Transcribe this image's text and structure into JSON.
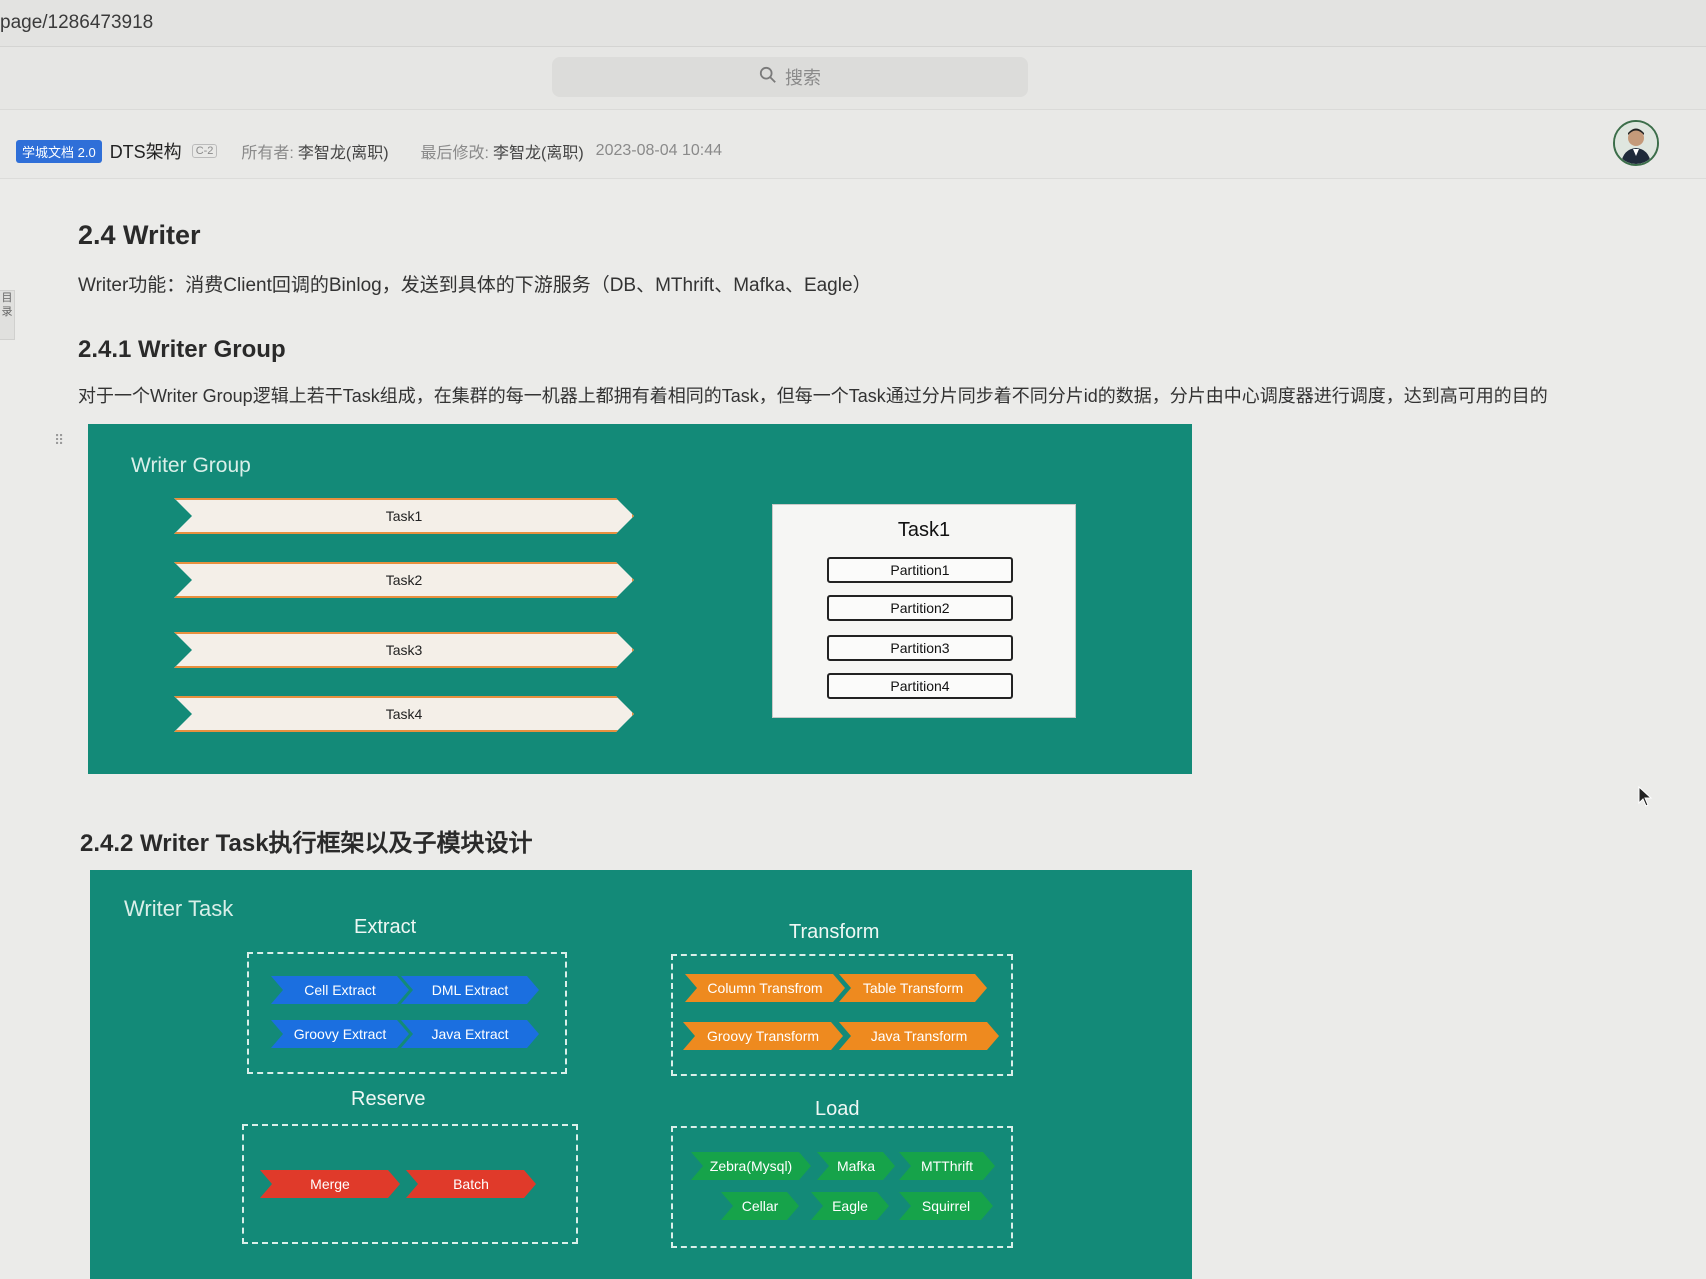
{
  "browser": {
    "url": "page/1286473918"
  },
  "search": {
    "placeholder": "搜索"
  },
  "doc": {
    "badge": "学城文档 2.0",
    "title": "DTS架构",
    "version": "C-2",
    "owner_label": "所有者:",
    "owner": "李智龙(离职)",
    "modified_label": "最后修改:",
    "modified_by": "李智龙(离职)",
    "modified_time": "2023-08-04 10:44"
  },
  "toc": {
    "label": "目录"
  },
  "content": {
    "h_writer": "2.4 Writer",
    "p_writer": "Writer功能：消费Client回调的Binlog，发送到具体的下游服务（DB、MThrift、Mafka、Eagle）",
    "h_group": "2.4.1 Writer Group",
    "p_group": "对于一个Writer Group逻辑上若干Task组成，在集群的每一机器上都拥有着相同的Task，但每一个Task通过分片同步着不同分片id的数据，分片由中心调度器进行调度，达到高可用的目的",
    "h_task": "2.4.2 Writer Task执行框架以及子模块设计"
  },
  "writer_group_diagram": {
    "title": "Writer Group",
    "tasks": [
      "Task1",
      "Task2",
      "Task3",
      "Task4"
    ],
    "detail_title": "Task1",
    "partitions": [
      "Partition1",
      "Partition2",
      "Partition3",
      "Partition4"
    ]
  },
  "writer_task_diagram": {
    "title": "Writer Task",
    "extract": {
      "title": "Extract",
      "items": [
        "Cell Extract",
        "DML Extract",
        "Groovy Extract",
        "Java Extract"
      ]
    },
    "transform": {
      "title": "Transform",
      "items": [
        "Column Transfrom",
        "Table Transform",
        "Groovy Transform",
        "Java Transform"
      ]
    },
    "reserve": {
      "title": "Reserve",
      "items": [
        "Merge",
        "Batch"
      ]
    },
    "load": {
      "title": "Load",
      "items": [
        "Zebra(Mysql)",
        "Mafka",
        "MTThrift",
        "Cellar",
        "Eagle",
        "Squirrel"
      ]
    }
  },
  "colors": {
    "diagram_bg": "#138a78",
    "task_arrow_border": "#e7903f",
    "extract_chip": "#1b6fe0",
    "transform_chip": "#ee8a1f",
    "reserve_chip": "#e03a2a",
    "load_chip": "#16a34a"
  },
  "icons": [
    "search-icon",
    "avatar",
    "cursor-icon",
    "drag-handle-icon"
  ]
}
